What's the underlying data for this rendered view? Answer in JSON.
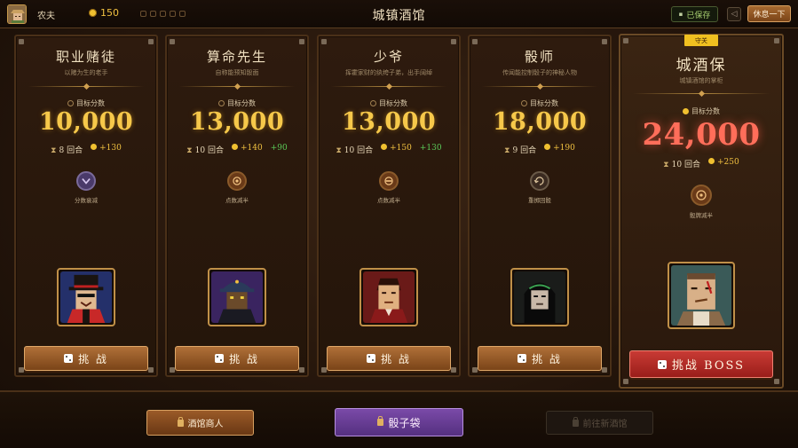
{
  "header": {
    "player_name": "农夫",
    "coins": "150",
    "title": "城镇酒馆",
    "saved_label": "已保存",
    "rest_label": "休息一下"
  },
  "opponents": [
    {
      "title": "职业赌徒",
      "subtitle": "以赌为生的老手",
      "target_label": "目标分数",
      "score": "10,000",
      "rounds": "8 回合",
      "coin_reward": "+130",
      "bonus": "",
      "ability": "分数衰减",
      "ability_icon": "purple-swirl-icon",
      "challenge_label": "挑 战"
    },
    {
      "title": "算命先生",
      "subtitle": "自称能预知骰面",
      "target_label": "目标分数",
      "score": "13,000",
      "rounds": "10 回合",
      "coin_reward": "+140",
      "bonus": "+90",
      "ability": "点数减半",
      "ability_icon": "eye-icon",
      "challenge_label": "挑 战"
    },
    {
      "title": "少爷",
      "subtitle": "挥霍家财的纨绔子弟，出手阔绰",
      "target_label": "目标分数",
      "score": "13,000",
      "rounds": "10 回合",
      "coin_reward": "+150",
      "bonus": "+130",
      "ability": "点数减半",
      "ability_icon": "minus-circle-icon",
      "challenge_label": "挑 战"
    },
    {
      "title": "骰师",
      "subtitle": "传闻能控制骰子的神秘人物",
      "target_label": "目标分数",
      "score": "18,000",
      "rounds": "9 回合",
      "coin_reward": "+190",
      "bonus": "",
      "ability": "重掷回骰",
      "ability_icon": "reroll-icon",
      "challenge_label": "挑 战"
    }
  ],
  "boss": {
    "badge": "守关",
    "title": "城酒保",
    "subtitle": "城镇酒馆的掌柜",
    "target_label": "目标分数",
    "score": "24,000",
    "rounds": "10 回合",
    "coin_reward": "+250",
    "ability": "骰牌减半",
    "ability_icon": "target-icon",
    "challenge_label": "挑战 BOSS"
  },
  "footer": {
    "merchant_label": "酒馆商人",
    "dicebag_label": "骰子袋",
    "new_tavern_label": "前往新酒馆"
  },
  "colors": {
    "score_gold": "#f6c84a",
    "boss_score": "#ff6e5a",
    "button_brown": "#9a5a28",
    "boss_button": "#b82c28",
    "dicebag_purple": "#6a40a0",
    "bonus_green": "#5ac858"
  }
}
